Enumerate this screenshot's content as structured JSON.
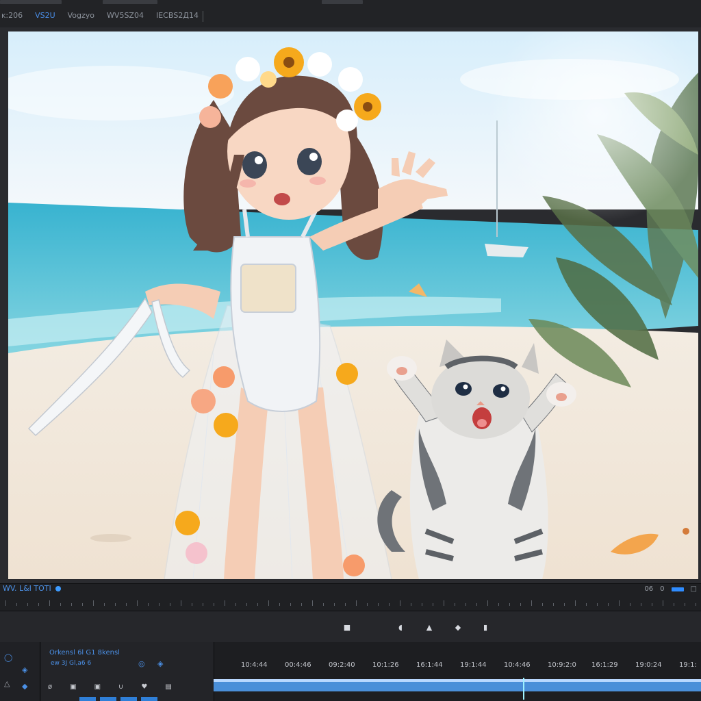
{
  "menu": [
    {
      "label": "ᴋ:206",
      "accent": false
    },
    {
      "label": "VS2U",
      "accent": true
    },
    {
      "label": "Vogzyo",
      "accent": false
    },
    {
      "label": "WV5SZ04",
      "accent": false
    },
    {
      "label": "IЕСВS2Д14",
      "accent": false
    }
  ],
  "viewer": {
    "scene": "beach-illustration"
  },
  "status": {
    "timecode_label": "WV. L&I TOTI",
    "right_label_1": "06",
    "right_label_2": "0"
  },
  "transport": {
    "buttons": [
      "■",
      "◖",
      "▲",
      "◆",
      "▮"
    ]
  },
  "timeline": {
    "sequence_name": "Orkensl 6l G1 8kensl",
    "sequence_sub": "ew 3J Gl,a6 6",
    "tool_glyphs": [
      "ø",
      "▣",
      "▣",
      "∪",
      "♥",
      "▤"
    ],
    "timecodes": [
      "10:4:44",
      "00:4:46",
      "09:2:40",
      "10:1:26",
      "16:1:44",
      "19:1:44",
      "10:4:46",
      "10:9:2:0",
      "16:1:29",
      "19:0:24",
      "19:1:"
    ]
  },
  "colors": {
    "accent": "#4a8ee8",
    "track": "#4a8fd9",
    "playhead": "#9ff2ff"
  }
}
